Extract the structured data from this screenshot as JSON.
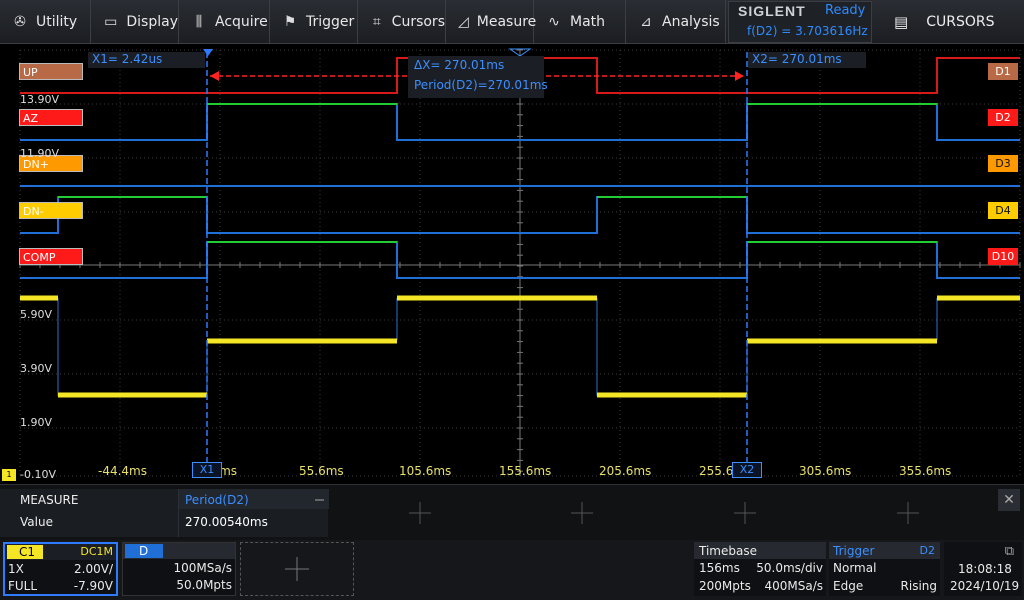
{
  "menu": {
    "utility": "Utility",
    "display": "Display",
    "acquire": "Acquire",
    "trigger": "Trigger",
    "cursors": "Cursors",
    "measure": "Measure",
    "math": "Math",
    "analysis": "Analysis"
  },
  "brand": {
    "name": "SIGLENT",
    "status": "Ready",
    "freq": "f(D2) = 3.703616Hz"
  },
  "side_panel": {
    "label": "CURSORS"
  },
  "channels": [
    {
      "label": "UP",
      "tag": "D1",
      "color": "#c0392b"
    },
    {
      "label": "AZ",
      "tag": "D2",
      "color": "#ff1a1a"
    },
    {
      "label": "DN+",
      "tag": "D3",
      "color": "#ff9900"
    },
    {
      "label": "DN-",
      "tag": "D4",
      "color": "#ffcc00"
    },
    {
      "label": "COMP",
      "tag": "D10",
      "color": "#ff1a1a"
    }
  ],
  "volt_labels": {
    "v1": "13.90V",
    "v2": "11.90V",
    "v3": "5.90V",
    "v4": "3.90V",
    "v5": "1.90V",
    "v6": "-0.10V"
  },
  "cursors": {
    "x1": "X1= 2.42us",
    "x2": "X2= 270.01ms",
    "dx": "ΔX= 270.01ms",
    "period": "Period(D2)=270.01ms",
    "x1_marker": "X1",
    "x2_marker": "X2"
  },
  "time_ticks": [
    "-44.4ms",
    "5.6ms",
    "55.6ms",
    "105.6ms",
    "155.6ms",
    "205.6ms",
    "255.6ms",
    "305.6ms",
    "355.6ms"
  ],
  "measure": {
    "header": "MEASURE",
    "row_label": "Value",
    "col_title": "Period(D2)",
    "col_value": "270.00540ms"
  },
  "c1": {
    "name": "C1",
    "coupling": "DC1M",
    "probe": "1X",
    "scale": "2.00V/",
    "bw": "FULL",
    "offset": "-7.90V"
  },
  "digital": {
    "name": "D",
    "rate": "100MSa/s",
    "pts": "50.0Mpts"
  },
  "timebase": {
    "title": "Timebase",
    "delay": "156ms",
    "scale": "50.0ms/div",
    "mem": "200Mpts",
    "rate": "400MSa/s"
  },
  "trigger": {
    "title": "Trigger",
    "source": "D2",
    "mode": "Normal",
    "type": "Edge",
    "slope": "Rising"
  },
  "clock": {
    "time": "18:08:18",
    "date": "2024/10/19"
  },
  "colors": {
    "c1": "#f5e625",
    "digital_high": "#22cc33",
    "digital_low": "#1f6fd6",
    "cursor": "#2e7bff",
    "trace_up": "#d11"
  }
}
